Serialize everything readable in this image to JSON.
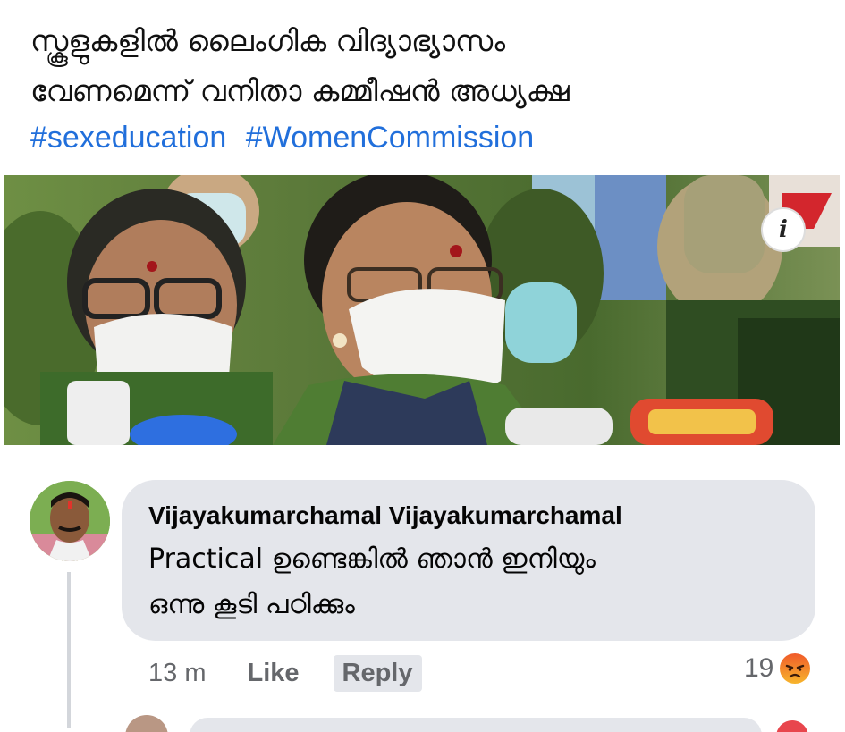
{
  "post": {
    "title_line1": "സ്കൂളുകളിൽ ലൈംഗിക വിദ്യാഭ്യാസം",
    "title_line2": "വേണമെന്ന് വനിതാ കമ്മീഷൻ അധ്യക്ഷ",
    "hashtags": [
      "#sexeducation",
      "#WomenCommission"
    ]
  },
  "photo": {
    "info_icon": "info-icon",
    "info_label": "i"
  },
  "comment": {
    "author": "Vijayakumarchamal Vijayakumarchamal",
    "text_line1": "Practical ഉണ്ടെങ്കിൽ ഞാൻ ഇനിയും",
    "text_line2": "ഒന്നു കൂടി പഠിക്കും",
    "time": "13 m",
    "like_label": "Like",
    "reply_label": "Reply",
    "reaction_count": "19",
    "reaction_icon": "angry-reaction-icon"
  },
  "colors": {
    "hashtag": "#216fdb",
    "bubble": "#e4e6eb",
    "meta_text": "#65676b"
  }
}
